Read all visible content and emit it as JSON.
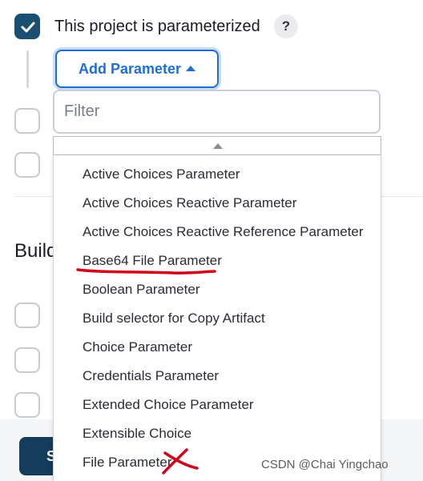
{
  "parameterized": {
    "checked": true,
    "label": "This project is parameterized",
    "help": "?"
  },
  "add_parameter": {
    "label": "Add Parameter"
  },
  "filter": {
    "placeholder": "Filter",
    "value": ""
  },
  "parameter_menu": {
    "items": [
      "Active Choices Parameter",
      "Active Choices Reactive Parameter",
      "Active Choices Reactive Reference Parameter",
      "Base64 File Parameter",
      "Boolean Parameter",
      "Build selector for Copy Artifact",
      "Choice Parameter",
      "Credentials Parameter",
      "Extended Choice Parameter",
      "Extensible Choice",
      "File Parameter"
    ]
  },
  "background": {
    "section_heading": "Build",
    "save_label": "S"
  },
  "watermark": "CSDN @Chai Yingchao",
  "colors": {
    "accent": "#1e6dd8",
    "checkbox_checked": "#1b4f72",
    "save_button": "#133d5b",
    "annotation": "#d0021b"
  }
}
